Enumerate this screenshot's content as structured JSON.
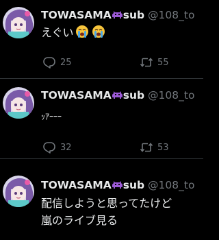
{
  "tweets": [
    {
      "display_name": "TOWASAMA",
      "suffix": "sub",
      "handle": "@108_to",
      "text_lines": [
        "えぐい"
      ],
      "emoji": [
        "crying-face",
        "crying-face"
      ],
      "reply_count": "25",
      "retweet_count": "55"
    },
    {
      "display_name": "TOWASAMA",
      "suffix": "sub",
      "handle": "@108_to",
      "text_lines": [
        "ｯｱｰｰｰ"
      ],
      "reply_count": "32",
      "retweet_count": "53"
    },
    {
      "display_name": "TOWASAMA",
      "suffix": "sub",
      "handle": "@108_to",
      "text_lines": [
        "配信しようと思ってたけど",
        "嵐のライブ見る"
      ]
    }
  ],
  "colors": {
    "background": "#000000",
    "text": "#e7e9ea",
    "muted": "#71767b",
    "divider": "#2f3336",
    "purple_accent": "#9b59d6"
  }
}
